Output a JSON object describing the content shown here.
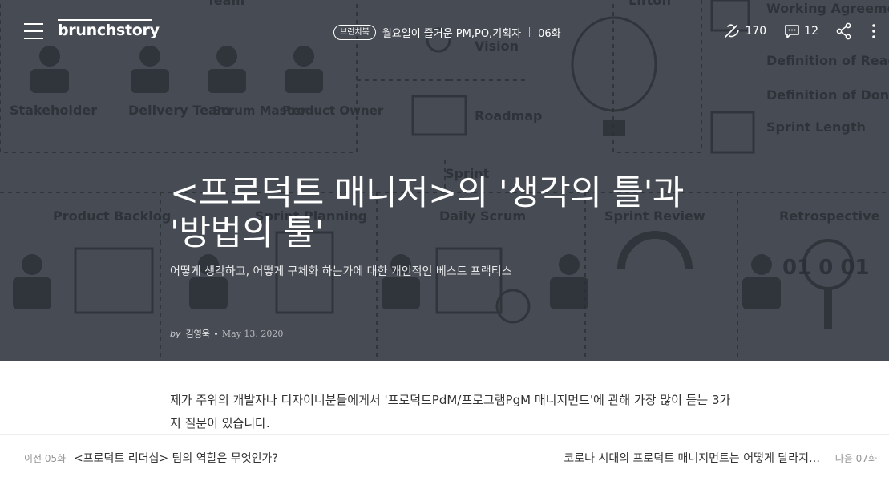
{
  "header": {
    "logo": "brunchstory",
    "magazine_badge": "브런치북",
    "magazine_title": "월요일이 즐거운 PM,PO,기획자",
    "episode": "06화",
    "like_count": "170",
    "comment_count": "12"
  },
  "hero": {
    "title": "<프로덕트 매니저>의 '생각의 틀'과 '방법의 툴'",
    "subtitle": "어떻게 생각하고, 어떻게 구체화 하는가에 대한 개인적인 베스트 프랙티스",
    "by": "by",
    "author": "김영욱",
    "date": "May 13. 2020",
    "background_labels": {
      "team": "Team",
      "stakeholder": "Stakeholder",
      "delivery_team": "Delivery Team",
      "scrum_master": "Scrum Master",
      "product_owner": "Product Owner",
      "vision": "Vision",
      "roadmap": "Roadmap",
      "liftoff": "Liftoff",
      "working_agreement": "Working Agreement",
      "definition_ready": "Definition of Ready",
      "definition_done": "Definition of Done",
      "sprint_length": "Sprint Length",
      "sprint": "Sprint",
      "product_backlog": "Product Backlog",
      "sprint_planning": "Sprint Planning",
      "daily_scrum": "Daily Scrum",
      "sprint_review": "Sprint Review",
      "retrospective": "Retrospective",
      "binary": "01 0 01"
    }
  },
  "article": {
    "paragraph_1": "제가 주위의 개발자나 디자이너분들에게서 '프로덕트PdM/프로그램PgM 매니지먼트'에 관해 가장 많이 듣는 3가지 질문이 있습니다."
  },
  "pager": {
    "prev_label": "이전 05화",
    "prev_title": "<프로덕트 리더십> 팀의 역할은 무엇인가?",
    "next_title": "코로나 시대의 프로덕트 매니지먼트는 어떻게 달라지…",
    "next_label": "다음 07화"
  },
  "colors": {
    "hero_bg": "#4f535c",
    "hero_line": "#2b2f36",
    "hero_text": "#ffffff",
    "body_text": "#333333",
    "muted_text": "#959595"
  },
  "icons": [
    "menu-icon",
    "book-icon",
    "like-icon",
    "comment-icon",
    "share-icon",
    "more-icon"
  ]
}
